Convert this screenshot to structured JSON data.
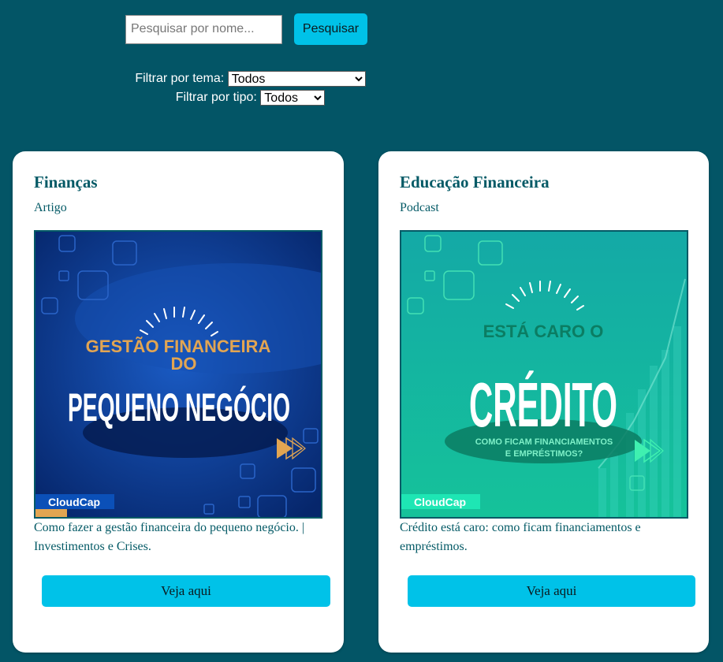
{
  "search": {
    "placeholder": "Pesquisar por nome...",
    "button_label": "Pesquisar"
  },
  "filters": {
    "tema_label": "Filtrar por tema:",
    "tema_selected": "Todos",
    "tipo_label": "Filtrar por tipo:",
    "tipo_selected": "Todos"
  },
  "cards": [
    {
      "title": "Finanças",
      "type": "Artigo",
      "image": {
        "line1": "GESTÃO FINANCEIRA",
        "line2": "DO",
        "line3": "PEQUENO NEGÓCIO",
        "brand": "CloudCap",
        "icon": "play-arrows-icon"
      },
      "description": "Como fazer a gestão financeira do pequeno negócio. | Investimentos e Crises.",
      "button_label": "Veja aqui"
    },
    {
      "title": "Educação Financeira",
      "type": "Podcast",
      "image": {
        "line1": "ESTÁ CARO O",
        "line2": "CRÉDITO",
        "line3": "COMO FICAM FINANCIAMENTOS",
        "line4": "E EMPRÉSTIMOS?",
        "brand": "CloudCap",
        "icon": "play-arrows-icon"
      },
      "description": "Crédito está caro: como ficam financiamentos e empréstimos.",
      "button_label": "Veja aqui"
    }
  ],
  "colors": {
    "background": "#035566",
    "accent": "#00c2e8",
    "card_text": "#045a66",
    "image1_bg": "#0b3b8a",
    "image1_highlight": "#e2a552",
    "image2_bg": "#15b8a0"
  }
}
